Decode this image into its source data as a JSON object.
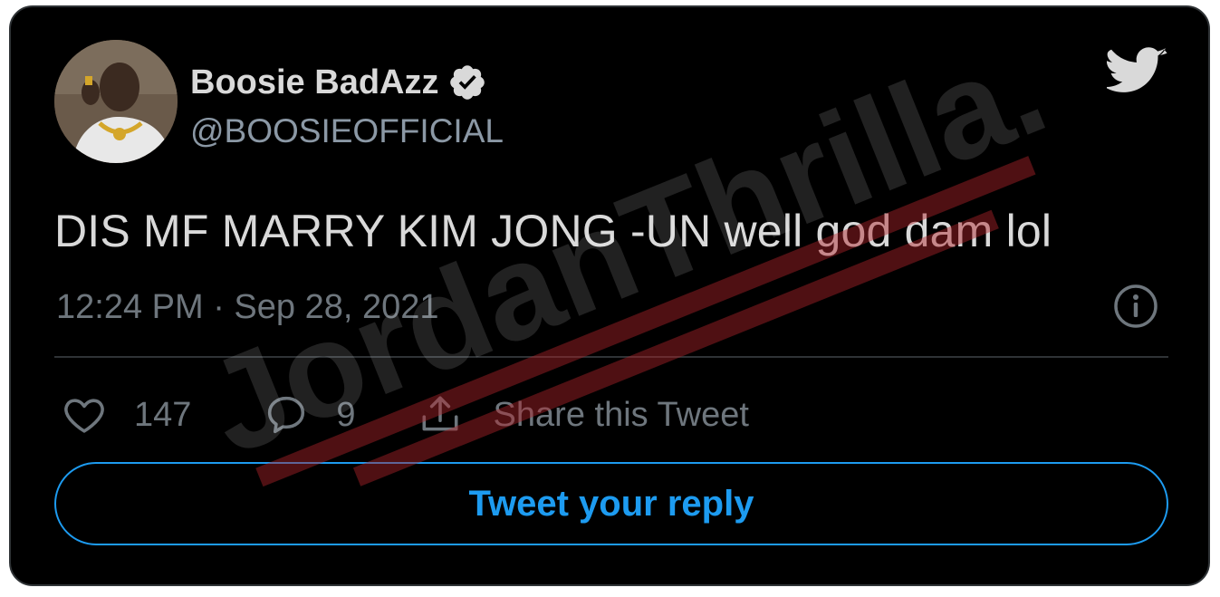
{
  "tweet": {
    "display_name": "Boosie BadAzz",
    "handle": "@BOOSIEOFFICIAL",
    "text": "DIS MF MARRY KIM JONG -UN well god dam lol",
    "timestamp": "12:24 PM · Sep 28, 2021",
    "likes": "147",
    "replies": "9",
    "share_label": "Share this Tweet",
    "reply_button_label": "Tweet your reply",
    "verified": true
  },
  "watermark": {
    "text": "JordanThrilla."
  },
  "colors": {
    "background": "#000000",
    "text": "#d9d9d9",
    "muted": "#6e767d",
    "accent": "#1d9bf0",
    "watermark_red": "#b0232a"
  },
  "icons": {
    "avatar": "profile-photo",
    "verified": "verified-badge-icon",
    "brand": "twitter-bird-icon",
    "info": "info-icon",
    "like": "heart-icon",
    "reply": "speech-bubble-icon",
    "share": "share-icon"
  }
}
